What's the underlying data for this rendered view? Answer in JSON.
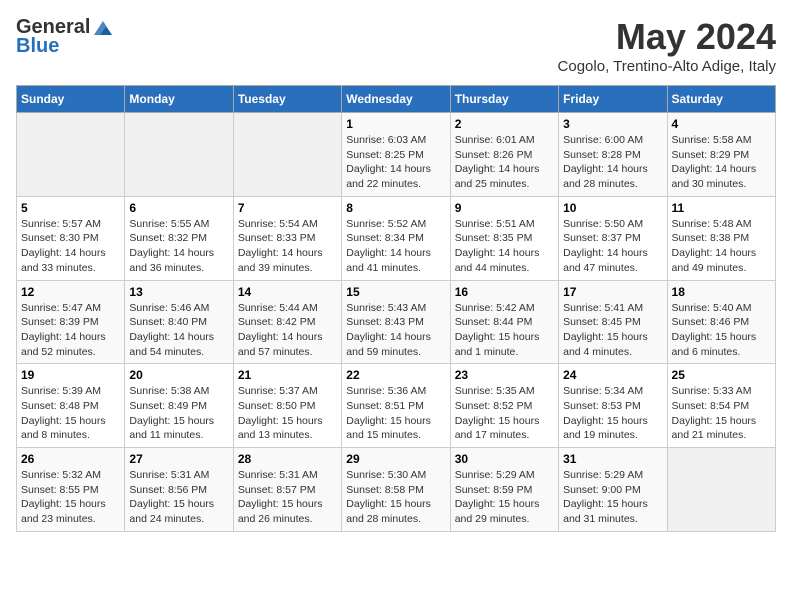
{
  "logo": {
    "general": "General",
    "blue": "Blue"
  },
  "title": "May 2024",
  "location": "Cogolo, Trentino-Alto Adige, Italy",
  "days_header": [
    "Sunday",
    "Monday",
    "Tuesday",
    "Wednesday",
    "Thursday",
    "Friday",
    "Saturday"
  ],
  "weeks": [
    [
      {
        "day": "",
        "info": ""
      },
      {
        "day": "",
        "info": ""
      },
      {
        "day": "",
        "info": ""
      },
      {
        "day": "1",
        "sunrise": "Sunrise: 6:03 AM",
        "sunset": "Sunset: 8:25 PM",
        "daylight": "Daylight: 14 hours and 22 minutes."
      },
      {
        "day": "2",
        "sunrise": "Sunrise: 6:01 AM",
        "sunset": "Sunset: 8:26 PM",
        "daylight": "Daylight: 14 hours and 25 minutes."
      },
      {
        "day": "3",
        "sunrise": "Sunrise: 6:00 AM",
        "sunset": "Sunset: 8:28 PM",
        "daylight": "Daylight: 14 hours and 28 minutes."
      },
      {
        "day": "4",
        "sunrise": "Sunrise: 5:58 AM",
        "sunset": "Sunset: 8:29 PM",
        "daylight": "Daylight: 14 hours and 30 minutes."
      }
    ],
    [
      {
        "day": "5",
        "sunrise": "Sunrise: 5:57 AM",
        "sunset": "Sunset: 8:30 PM",
        "daylight": "Daylight: 14 hours and 33 minutes."
      },
      {
        "day": "6",
        "sunrise": "Sunrise: 5:55 AM",
        "sunset": "Sunset: 8:32 PM",
        "daylight": "Daylight: 14 hours and 36 minutes."
      },
      {
        "day": "7",
        "sunrise": "Sunrise: 5:54 AM",
        "sunset": "Sunset: 8:33 PM",
        "daylight": "Daylight: 14 hours and 39 minutes."
      },
      {
        "day": "8",
        "sunrise": "Sunrise: 5:52 AM",
        "sunset": "Sunset: 8:34 PM",
        "daylight": "Daylight: 14 hours and 41 minutes."
      },
      {
        "day": "9",
        "sunrise": "Sunrise: 5:51 AM",
        "sunset": "Sunset: 8:35 PM",
        "daylight": "Daylight: 14 hours and 44 minutes."
      },
      {
        "day": "10",
        "sunrise": "Sunrise: 5:50 AM",
        "sunset": "Sunset: 8:37 PM",
        "daylight": "Daylight: 14 hours and 47 minutes."
      },
      {
        "day": "11",
        "sunrise": "Sunrise: 5:48 AM",
        "sunset": "Sunset: 8:38 PM",
        "daylight": "Daylight: 14 hours and 49 minutes."
      }
    ],
    [
      {
        "day": "12",
        "sunrise": "Sunrise: 5:47 AM",
        "sunset": "Sunset: 8:39 PM",
        "daylight": "Daylight: 14 hours and 52 minutes."
      },
      {
        "day": "13",
        "sunrise": "Sunrise: 5:46 AM",
        "sunset": "Sunset: 8:40 PM",
        "daylight": "Daylight: 14 hours and 54 minutes."
      },
      {
        "day": "14",
        "sunrise": "Sunrise: 5:44 AM",
        "sunset": "Sunset: 8:42 PM",
        "daylight": "Daylight: 14 hours and 57 minutes."
      },
      {
        "day": "15",
        "sunrise": "Sunrise: 5:43 AM",
        "sunset": "Sunset: 8:43 PM",
        "daylight": "Daylight: 14 hours and 59 minutes."
      },
      {
        "day": "16",
        "sunrise": "Sunrise: 5:42 AM",
        "sunset": "Sunset: 8:44 PM",
        "daylight": "Daylight: 15 hours and 1 minute."
      },
      {
        "day": "17",
        "sunrise": "Sunrise: 5:41 AM",
        "sunset": "Sunset: 8:45 PM",
        "daylight": "Daylight: 15 hours and 4 minutes."
      },
      {
        "day": "18",
        "sunrise": "Sunrise: 5:40 AM",
        "sunset": "Sunset: 8:46 PM",
        "daylight": "Daylight: 15 hours and 6 minutes."
      }
    ],
    [
      {
        "day": "19",
        "sunrise": "Sunrise: 5:39 AM",
        "sunset": "Sunset: 8:48 PM",
        "daylight": "Daylight: 15 hours and 8 minutes."
      },
      {
        "day": "20",
        "sunrise": "Sunrise: 5:38 AM",
        "sunset": "Sunset: 8:49 PM",
        "daylight": "Daylight: 15 hours and 11 minutes."
      },
      {
        "day": "21",
        "sunrise": "Sunrise: 5:37 AM",
        "sunset": "Sunset: 8:50 PM",
        "daylight": "Daylight: 15 hours and 13 minutes."
      },
      {
        "day": "22",
        "sunrise": "Sunrise: 5:36 AM",
        "sunset": "Sunset: 8:51 PM",
        "daylight": "Daylight: 15 hours and 15 minutes."
      },
      {
        "day": "23",
        "sunrise": "Sunrise: 5:35 AM",
        "sunset": "Sunset: 8:52 PM",
        "daylight": "Daylight: 15 hours and 17 minutes."
      },
      {
        "day": "24",
        "sunrise": "Sunrise: 5:34 AM",
        "sunset": "Sunset: 8:53 PM",
        "daylight": "Daylight: 15 hours and 19 minutes."
      },
      {
        "day": "25",
        "sunrise": "Sunrise: 5:33 AM",
        "sunset": "Sunset: 8:54 PM",
        "daylight": "Daylight: 15 hours and 21 minutes."
      }
    ],
    [
      {
        "day": "26",
        "sunrise": "Sunrise: 5:32 AM",
        "sunset": "Sunset: 8:55 PM",
        "daylight": "Daylight: 15 hours and 23 minutes."
      },
      {
        "day": "27",
        "sunrise": "Sunrise: 5:31 AM",
        "sunset": "Sunset: 8:56 PM",
        "daylight": "Daylight: 15 hours and 24 minutes."
      },
      {
        "day": "28",
        "sunrise": "Sunrise: 5:31 AM",
        "sunset": "Sunset: 8:57 PM",
        "daylight": "Daylight: 15 hours and 26 minutes."
      },
      {
        "day": "29",
        "sunrise": "Sunrise: 5:30 AM",
        "sunset": "Sunset: 8:58 PM",
        "daylight": "Daylight: 15 hours and 28 minutes."
      },
      {
        "day": "30",
        "sunrise": "Sunrise: 5:29 AM",
        "sunset": "Sunset: 8:59 PM",
        "daylight": "Daylight: 15 hours and 29 minutes."
      },
      {
        "day": "31",
        "sunrise": "Sunrise: 5:29 AM",
        "sunset": "Sunset: 9:00 PM",
        "daylight": "Daylight: 15 hours and 31 minutes."
      },
      {
        "day": "",
        "info": ""
      }
    ]
  ]
}
